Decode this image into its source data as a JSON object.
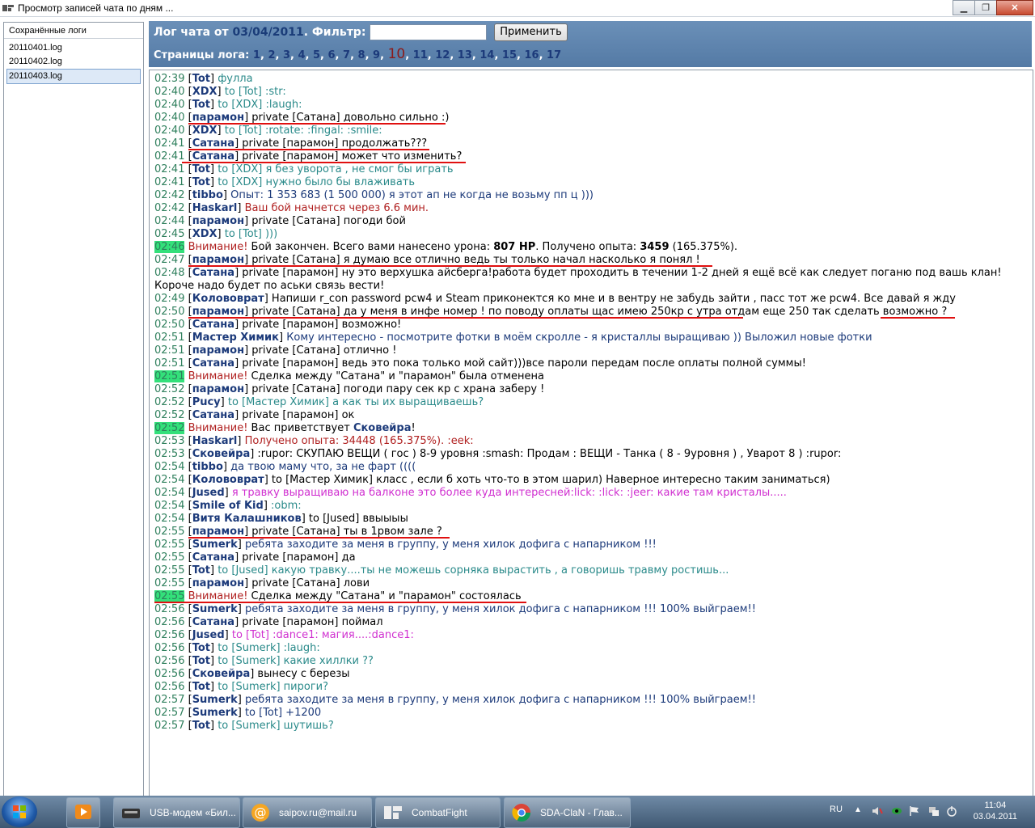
{
  "window": {
    "title": "Просмотр записей чата по дням ..."
  },
  "sidebar": {
    "header": "Сохранённые логи",
    "files": [
      "20110401.log",
      "20110402.log",
      "20110403.log"
    ],
    "selected_index": 2
  },
  "header": {
    "title_prefix": "Лог чата от",
    "date": "03/04/2011",
    "filter_label": ". Фильтр:",
    "filter_value": "",
    "apply_label": "Применить",
    "pages_label": "Страницы лога:",
    "pages": [
      "1",
      "2",
      "3",
      "4",
      "5",
      "6",
      "7",
      "8",
      "9",
      "10",
      "11",
      "12",
      "13",
      "14",
      "15",
      "16",
      "17"
    ],
    "current_page": "10"
  },
  "log": [
    {
      "time": "02:39",
      "segs": [
        [
          "n",
          "Tot"
        ],
        [
          "cy",
          " фулла"
        ]
      ]
    },
    {
      "time": "02:40",
      "segs": [
        [
          "n",
          "XDX"
        ],
        [
          "cy",
          " to [Tot] :str:"
        ]
      ]
    },
    {
      "time": "02:40",
      "segs": [
        [
          "n",
          "Tot"
        ],
        [
          "cy",
          " to [XDX] :laugh:"
        ]
      ]
    },
    {
      "time": "02:40",
      "segs": [
        [
          "n",
          "парамон"
        ],
        [
          "blk",
          " private [Сатана] довольно сильно :)"
        ]
      ]
    },
    {
      "time": "02:40",
      "segs": [
        [
          "n",
          "XDX"
        ],
        [
          "cy",
          " to [Tot] :rotate: :fingal: :smile:"
        ]
      ]
    },
    {
      "time": "02:41",
      "segs": [
        [
          "n",
          "Сатана"
        ],
        [
          "blk",
          " private [парамон] продолжать???"
        ]
      ]
    },
    {
      "time": "02:41",
      "segs": [
        [
          "n",
          "Сатана"
        ],
        [
          "blk",
          " private [парамон] может что изменить?"
        ]
      ]
    },
    {
      "time": "02:41",
      "segs": [
        [
          "n",
          "Tot"
        ],
        [
          "cy",
          " to [XDX] я без уворота , не смог бы играть"
        ]
      ]
    },
    {
      "time": "02:41",
      "segs": [
        [
          "n",
          "Tot"
        ],
        [
          "cy",
          " to [XDX] нужно было бы влаживать"
        ]
      ]
    },
    {
      "time": "02:42",
      "segs": [
        [
          "n",
          "tibbo"
        ],
        [
          "bl",
          " Опыт: 1 353 683 (1 500 000) я этот ап не когда не возьму пп ц )))"
        ]
      ]
    },
    {
      "time": "02:42",
      "segs": [
        [
          "n",
          "Haskarl"
        ],
        [
          "rd",
          " Ваш бой начнется через 6.6 мин."
        ]
      ]
    },
    {
      "time": "02:44",
      "segs": [
        [
          "n",
          "парамон"
        ],
        [
          "blk",
          " private [Сатана] погоди бой"
        ]
      ]
    },
    {
      "time": "02:45",
      "segs": [
        [
          "n",
          "XDX"
        ],
        [
          "cy",
          " to [Tot] )))"
        ]
      ]
    },
    {
      "time": "02:46",
      "hl": true,
      "segs": [
        [
          "rdraw",
          "Внимание!"
        ],
        [
          "blkraw",
          " Бой закончен. Всего вами нанесено урона: "
        ],
        [
          "braw",
          "807 HP"
        ],
        [
          "blkraw",
          ". Получено опыта: "
        ],
        [
          "braw",
          "3459"
        ],
        [
          "blkraw",
          " (165.375%)."
        ]
      ]
    },
    {
      "time": "02:47",
      "segs": [
        [
          "n",
          "парамон"
        ],
        [
          "blk",
          " private [Сатана] я думаю все отлично ведь ты только начал насколько я понял !"
        ]
      ]
    },
    {
      "time": "02:48",
      "wrap": true,
      "segs": [
        [
          "n",
          "Сатана"
        ],
        [
          "blk",
          " private [парамон] ну это верхушка айсберга!работа будет проходить в течении 1-2 дней я ещё всё как следует поганю под вашь клан! Короче надо будет по аськи связь вести!"
        ]
      ]
    },
    {
      "time": "02:49",
      "segs": [
        [
          "n",
          "Колововрат"
        ],
        [
          "blk",
          " Напиши r_con password pcw4 и Steam приконектся ко мне и в вентру не забудь зайти , пасс тот же pcw4. Все давай я жду"
        ]
      ]
    },
    {
      "time": "02:50",
      "segs": [
        [
          "n",
          "парамон"
        ],
        [
          "blk",
          " private [Сатана] да у меня в инфе номер ! по поводу оплаты щас имею 250кр с утра отдам еще 250 так сделать возможно ?"
        ]
      ]
    },
    {
      "time": "02:50",
      "segs": [
        [
          "n",
          "Сатана"
        ],
        [
          "blk",
          " private [парамон] возможно!"
        ]
      ]
    },
    {
      "time": "02:51",
      "segs": [
        [
          "n",
          "Мастер Химик"
        ],
        [
          "bl",
          " Кому интересно - посмотрите фотки в моём скролле - я кристаллы выращиваю )) Выложил новые фотки"
        ]
      ]
    },
    {
      "time": "02:51",
      "segs": [
        [
          "n",
          "парамон"
        ],
        [
          "blk",
          " private [Сатана] отлично !"
        ]
      ]
    },
    {
      "time": "02:51",
      "segs": [
        [
          "n",
          "Сатана"
        ],
        [
          "blk",
          " private [парамон] ведь это пока только мой сайт)))все пароли передам после оплаты полной суммы!"
        ]
      ]
    },
    {
      "time": "02:51",
      "hl": true,
      "segs": [
        [
          "rdraw",
          "Внимание!"
        ],
        [
          "blkraw",
          " Сделка между \"Сатана\" и \"парамон\" была отменена"
        ]
      ]
    },
    {
      "time": "02:52",
      "segs": [
        [
          "n",
          "парамон"
        ],
        [
          "blk",
          " private [Сатана] погоди пару сек кр с храна заберу !"
        ]
      ]
    },
    {
      "time": "02:52",
      "segs": [
        [
          "n",
          "Pucy"
        ],
        [
          "cy",
          " to [Мастер Химик] а как ты их выращиваешь?"
        ]
      ]
    },
    {
      "time": "02:52",
      "segs": [
        [
          "n",
          "Сатана"
        ],
        [
          "blk",
          " private [парамон] ок"
        ]
      ]
    },
    {
      "time": "02:52",
      "hl": true,
      "segs": [
        [
          "rdraw",
          "Внимание!"
        ],
        [
          "blkraw",
          " Вас приветствует "
        ],
        [
          "nraw",
          "Сковейра"
        ],
        [
          "blkraw",
          "!"
        ]
      ]
    },
    {
      "time": "02:53",
      "segs": [
        [
          "n",
          "Haskarl"
        ],
        [
          "rd",
          " Получено опыта: 34448 (165.375%). :eek:"
        ]
      ]
    },
    {
      "time": "02:53",
      "segs": [
        [
          "n",
          "Сковейра"
        ],
        [
          "blk",
          " :rupor: СКУПАЮ ВЕЩИ ( гос ) 8-9 уровня :smash: Продам : ВЕЩИ - Танка ( 8 - 9уровня ) , Уварот 8 ) :rupor:"
        ]
      ]
    },
    {
      "time": "02:54",
      "segs": [
        [
          "n",
          "tibbo"
        ],
        [
          "bl",
          " да твою маму что, за не фарт (((("
        ]
      ]
    },
    {
      "time": "02:54",
      "segs": [
        [
          "n",
          "Колововрат"
        ],
        [
          "blk",
          " to [Мастер Химик] класс , если б хоть что-то в этом шарил) Наверное интересно таким заниматься)"
        ]
      ]
    },
    {
      "time": "02:54",
      "segs": [
        [
          "n",
          "Jused"
        ],
        [
          "mg",
          " я травку выращиваю на балконе это более куда интересней:lick: :lick: :jeer: какие там кристалы....."
        ]
      ]
    },
    {
      "time": "02:54",
      "segs": [
        [
          "n",
          "Smile of Kid"
        ],
        [
          "cy",
          " :obm:"
        ]
      ]
    },
    {
      "time": "02:54",
      "segs": [
        [
          "n",
          "Витя Калашников"
        ],
        [
          "blk",
          " to [Jused] ввыыыы"
        ]
      ]
    },
    {
      "time": "02:55",
      "segs": [
        [
          "n",
          "парамон"
        ],
        [
          "blk",
          " private [Сатана] ты в 1рвом зале ?"
        ]
      ]
    },
    {
      "time": "02:55",
      "segs": [
        [
          "n",
          "Sumerk"
        ],
        [
          "bl",
          " ребята заходите за меня в группу, у меня хилок дофига с напарником !!!"
        ]
      ]
    },
    {
      "time": "02:55",
      "segs": [
        [
          "n",
          "Сатана"
        ],
        [
          "blk",
          " private [парамон] да"
        ]
      ]
    },
    {
      "time": "02:55",
      "segs": [
        [
          "n",
          "Tot"
        ],
        [
          "cy",
          " to [Jused] какую травку....ты не можешь сорняка вырастить , а говоришь травму ростишь..."
        ]
      ]
    },
    {
      "time": "02:55",
      "segs": [
        [
          "n",
          "парамон"
        ],
        [
          "blk",
          " private [Сатана] лови"
        ]
      ]
    },
    {
      "time": "02:55",
      "hl": true,
      "segs": [
        [
          "rdraw",
          "Внимание!"
        ],
        [
          "blkraw",
          " Сделка между \"Сатана\" и \"парамон\" состоялась"
        ]
      ]
    },
    {
      "time": "02:56",
      "segs": [
        [
          "n",
          "Sumerk"
        ],
        [
          "bl",
          " ребята заходите за меня в группу, у меня хилок дофига с напарником !!! 100% выйграем!!"
        ]
      ]
    },
    {
      "time": "02:56",
      "segs": [
        [
          "n",
          "Сатана"
        ],
        [
          "blk",
          " private [парамон] поймал"
        ]
      ]
    },
    {
      "time": "02:56",
      "segs": [
        [
          "n",
          "Jused"
        ],
        [
          "mg",
          " to [Tot] :dance1: магия....:dance1:"
        ]
      ]
    },
    {
      "time": "02:56",
      "segs": [
        [
          "n",
          "Tot"
        ],
        [
          "cy",
          " to [Sumerk] :laugh:"
        ]
      ]
    },
    {
      "time": "02:56",
      "segs": [
        [
          "n",
          "Tot"
        ],
        [
          "cy",
          " to [Sumerk] какие хиллки ??"
        ]
      ]
    },
    {
      "time": "02:56",
      "segs": [
        [
          "n",
          "Сковейра"
        ],
        [
          "blk",
          " вынесу с березы"
        ]
      ]
    },
    {
      "time": "02:56",
      "segs": [
        [
          "n",
          "Tot"
        ],
        [
          "cy",
          " to [Sumerk] пироги?"
        ]
      ]
    },
    {
      "time": "02:57",
      "segs": [
        [
          "n",
          "Sumerk"
        ],
        [
          "bl",
          " ребята заходите за меня в группу, у меня хилок дофига с напарником !!! 100% выйграем!!"
        ]
      ]
    },
    {
      "time": "02:57",
      "segs": [
        [
          "n",
          "Sumerk"
        ],
        [
          "bl",
          " to [Tot] +1200"
        ]
      ]
    },
    {
      "time": "02:57",
      "segs": [
        [
          "n",
          "Tot"
        ],
        [
          "cy",
          " to [Sumerk] шутишь?"
        ]
      ]
    }
  ],
  "taskbar": {
    "items": [
      "USB-модем «Бил...",
      "saipov.ru@mail.ru",
      "CombatFight",
      "SDA-ClaN - Глав..."
    ],
    "lang": "RU",
    "time": "11:04",
    "date": "03.04.2011"
  }
}
